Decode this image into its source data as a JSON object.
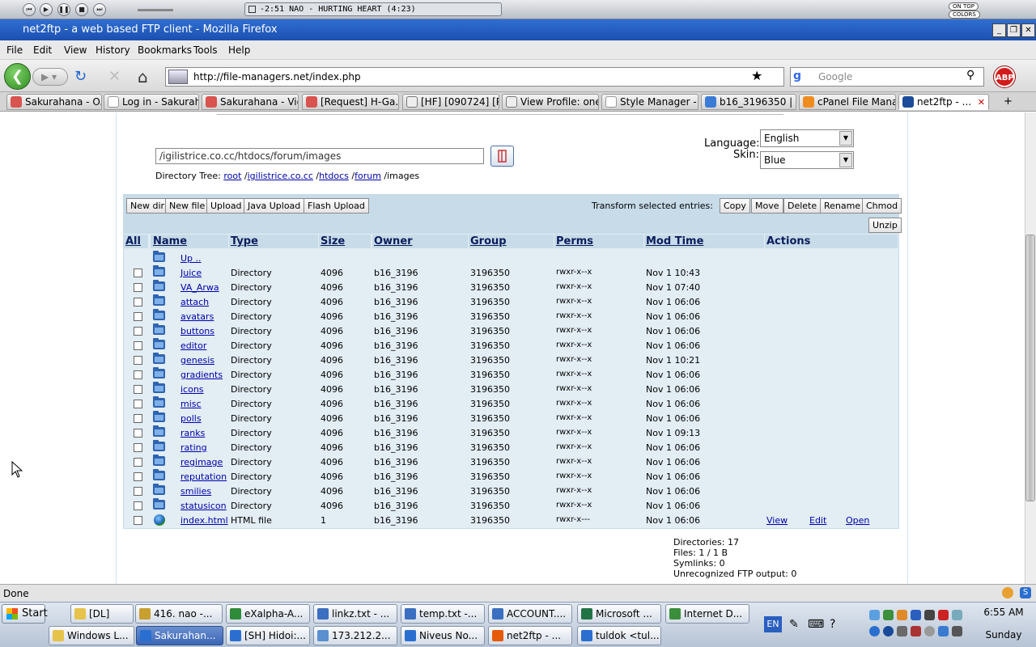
{
  "winamp": {
    "track": "-2:51  NAO - HURTING HEART (4:23)",
    "eq_label": "ON TOP",
    "colors_label": "COLORS"
  },
  "window": {
    "title": "net2ftp - a web based FTP client - Mozilla Firefox"
  },
  "menu": [
    "File",
    "Edit",
    "View",
    "History",
    "Bookmarks",
    "Tools",
    "Help"
  ],
  "nav": {
    "url": "http://file-managers.net/index.php",
    "search_placeholder": "Google",
    "abp": "ABP"
  },
  "tabs": [
    {
      "label": "Sakurahana - O...",
      "color": "#d9534f"
    },
    {
      "label": "Log in - Sakurah...",
      "color": "#ffffff"
    },
    {
      "label": "Sakurahana - Vie...",
      "color": "#d9534f"
    },
    {
      "label": "[Request] H-Ga...",
      "color": "#d9534f"
    },
    {
      "label": "[HF] [090724] [P...",
      "color": "#f0f0f0"
    },
    {
      "label": "View Profile: one...",
      "color": "#f0f0f0"
    },
    {
      "label": "Style Manager - ...",
      "color": "#ffffff"
    },
    {
      "label": "b16_3196350 | ...",
      "color": "#3a7bd5"
    },
    {
      "label": "cPanel File Mana...",
      "color": "#f08c1e"
    },
    {
      "label": "net2ftp - ...",
      "color": "#1a4c9a"
    }
  ],
  "app": {
    "directory": "/igilistrice.co.cc/htdocs/forum/images",
    "tree_label": "Directory Tree:",
    "tree": [
      "root",
      "igilistrice.co.cc",
      "htdocs",
      "forum"
    ],
    "tree_current": "images",
    "language_label": "Language:",
    "language_value": "English",
    "skin_label": "Skin:",
    "skin_value": "Blue",
    "buttons_left": [
      "New dir",
      "New file",
      "Upload",
      "Java Upload",
      "Flash Upload"
    ],
    "transform_label": "Transform selected entries:",
    "buttons_right": [
      "Copy",
      "Move",
      "Delete",
      "Rename",
      "Chmod"
    ],
    "unzip": "Unzip",
    "columns": [
      "All",
      "Name",
      "Type",
      "Size",
      "Owner",
      "Group",
      "Perms",
      "Mod Time",
      "Actions"
    ],
    "up_label": "Up ..",
    "rows": [
      {
        "name": "Juice",
        "type": "Directory",
        "size": "4096",
        "owner": "b16_3196",
        "group": "3196350",
        "perms": "rwxr-x--x",
        "mtime": "Nov 1 10:43"
      },
      {
        "name": "VA_Arwa",
        "type": "Directory",
        "size": "4096",
        "owner": "b16_3196",
        "group": "3196350",
        "perms": "rwxr-x--x",
        "mtime": "Nov 1 07:40"
      },
      {
        "name": "attach",
        "type": "Directory",
        "size": "4096",
        "owner": "b16_3196",
        "group": "3196350",
        "perms": "rwxr-x--x",
        "mtime": "Nov 1 06:06"
      },
      {
        "name": "avatars",
        "type": "Directory",
        "size": "4096",
        "owner": "b16_3196",
        "group": "3196350",
        "perms": "rwxr-x--x",
        "mtime": "Nov 1 06:06"
      },
      {
        "name": "buttons",
        "type": "Directory",
        "size": "4096",
        "owner": "b16_3196",
        "group": "3196350",
        "perms": "rwxr-x--x",
        "mtime": "Nov 1 06:06"
      },
      {
        "name": "editor",
        "type": "Directory",
        "size": "4096",
        "owner": "b16_3196",
        "group": "3196350",
        "perms": "rwxr-x--x",
        "mtime": "Nov 1 06:06"
      },
      {
        "name": "genesis",
        "type": "Directory",
        "size": "4096",
        "owner": "b16_3196",
        "group": "3196350",
        "perms": "rwxr-x--x",
        "mtime": "Nov 1 10:21"
      },
      {
        "name": "gradients",
        "type": "Directory",
        "size": "4096",
        "owner": "b16_3196",
        "group": "3196350",
        "perms": "rwxr-x--x",
        "mtime": "Nov 1 06:06"
      },
      {
        "name": "icons",
        "type": "Directory",
        "size": "4096",
        "owner": "b16_3196",
        "group": "3196350",
        "perms": "rwxr-x--x",
        "mtime": "Nov 1 06:06"
      },
      {
        "name": "misc",
        "type": "Directory",
        "size": "4096",
        "owner": "b16_3196",
        "group": "3196350",
        "perms": "rwxr-x--x",
        "mtime": "Nov 1 06:06"
      },
      {
        "name": "polls",
        "type": "Directory",
        "size": "4096",
        "owner": "b16_3196",
        "group": "3196350",
        "perms": "rwxr-x--x",
        "mtime": "Nov 1 06:06"
      },
      {
        "name": "ranks",
        "type": "Directory",
        "size": "4096",
        "owner": "b16_3196",
        "group": "3196350",
        "perms": "rwxr-x--x",
        "mtime": "Nov 1 09:13"
      },
      {
        "name": "rating",
        "type": "Directory",
        "size": "4096",
        "owner": "b16_3196",
        "group": "3196350",
        "perms": "rwxr-x--x",
        "mtime": "Nov 1 06:06"
      },
      {
        "name": "regimage",
        "type": "Directory",
        "size": "4096",
        "owner": "b16_3196",
        "group": "3196350",
        "perms": "rwxr-x--x",
        "mtime": "Nov 1 06:06"
      },
      {
        "name": "reputation",
        "type": "Directory",
        "size": "4096",
        "owner": "b16_3196",
        "group": "3196350",
        "perms": "rwxr-x--x",
        "mtime": "Nov 1 06:06"
      },
      {
        "name": "smilies",
        "type": "Directory",
        "size": "4096",
        "owner": "b16_3196",
        "group": "3196350",
        "perms": "rwxr-x--x",
        "mtime": "Nov 1 06:06"
      },
      {
        "name": "statusicon",
        "type": "Directory",
        "size": "4096",
        "owner": "b16_3196",
        "group": "3196350",
        "perms": "rwxr-x--x",
        "mtime": "Nov 1 06:06"
      },
      {
        "name": "index.html",
        "type": "HTML file",
        "size": "1",
        "owner": "b16_3196",
        "group": "3196350",
        "perms": "rwxr-x---",
        "mtime": "Nov 1 06:06",
        "actions": [
          "View",
          "Edit",
          "Open"
        ]
      }
    ],
    "stats": [
      "Directories: 17",
      "Files: 1 / 1 B",
      "Symlinks: 0",
      "Unrecognized FTP output: 0"
    ]
  },
  "status": "Done",
  "taskbar": {
    "start": "Start",
    "row1": [
      "[DL]",
      "416. nao -...",
      "eXalpha-A...",
      "linkz.txt - ...",
      "temp.txt -...",
      "ACCOUNT....",
      "Microsoft ...",
      "Internet D..."
    ],
    "row2": [
      "Windows L...",
      "Sakurahan...",
      "[SH] Hidoi:...",
      "173.212.2...",
      "Niveus No...",
      "net2ftp - ...",
      "tuldok <tul..."
    ],
    "lang": "EN",
    "time": "6:55 AM",
    "day": "Sunday"
  }
}
